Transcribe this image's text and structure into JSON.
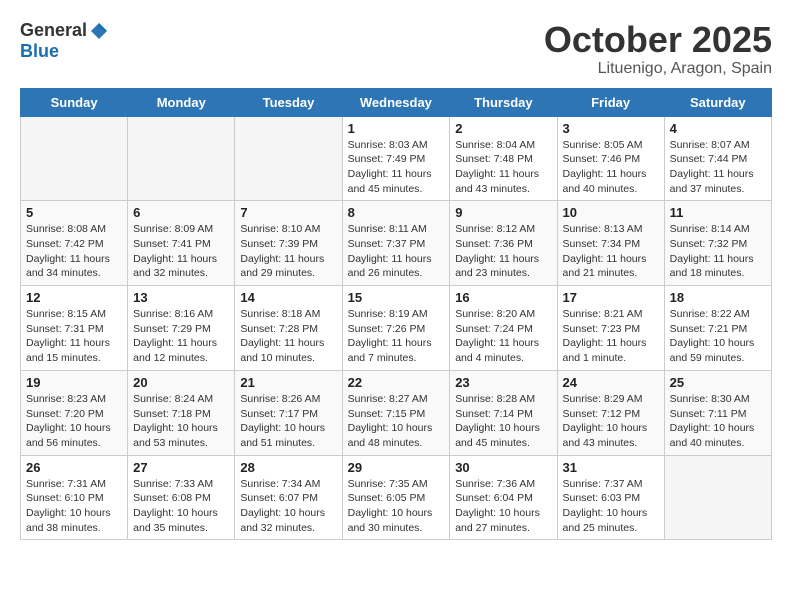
{
  "header": {
    "logo_general": "General",
    "logo_blue": "Blue",
    "month_title": "October 2025",
    "location": "Lituenigo, Aragon, Spain"
  },
  "weekdays": [
    "Sunday",
    "Monday",
    "Tuesday",
    "Wednesday",
    "Thursday",
    "Friday",
    "Saturday"
  ],
  "weeks": [
    [
      {
        "day": "",
        "info": ""
      },
      {
        "day": "",
        "info": ""
      },
      {
        "day": "",
        "info": ""
      },
      {
        "day": "1",
        "info": "Sunrise: 8:03 AM\nSunset: 7:49 PM\nDaylight: 11 hours and 45 minutes."
      },
      {
        "day": "2",
        "info": "Sunrise: 8:04 AM\nSunset: 7:48 PM\nDaylight: 11 hours and 43 minutes."
      },
      {
        "day": "3",
        "info": "Sunrise: 8:05 AM\nSunset: 7:46 PM\nDaylight: 11 hours and 40 minutes."
      },
      {
        "day": "4",
        "info": "Sunrise: 8:07 AM\nSunset: 7:44 PM\nDaylight: 11 hours and 37 minutes."
      }
    ],
    [
      {
        "day": "5",
        "info": "Sunrise: 8:08 AM\nSunset: 7:42 PM\nDaylight: 11 hours and 34 minutes."
      },
      {
        "day": "6",
        "info": "Sunrise: 8:09 AM\nSunset: 7:41 PM\nDaylight: 11 hours and 32 minutes."
      },
      {
        "day": "7",
        "info": "Sunrise: 8:10 AM\nSunset: 7:39 PM\nDaylight: 11 hours and 29 minutes."
      },
      {
        "day": "8",
        "info": "Sunrise: 8:11 AM\nSunset: 7:37 PM\nDaylight: 11 hours and 26 minutes."
      },
      {
        "day": "9",
        "info": "Sunrise: 8:12 AM\nSunset: 7:36 PM\nDaylight: 11 hours and 23 minutes."
      },
      {
        "day": "10",
        "info": "Sunrise: 8:13 AM\nSunset: 7:34 PM\nDaylight: 11 hours and 21 minutes."
      },
      {
        "day": "11",
        "info": "Sunrise: 8:14 AM\nSunset: 7:32 PM\nDaylight: 11 hours and 18 minutes."
      }
    ],
    [
      {
        "day": "12",
        "info": "Sunrise: 8:15 AM\nSunset: 7:31 PM\nDaylight: 11 hours and 15 minutes."
      },
      {
        "day": "13",
        "info": "Sunrise: 8:16 AM\nSunset: 7:29 PM\nDaylight: 11 hours and 12 minutes."
      },
      {
        "day": "14",
        "info": "Sunrise: 8:18 AM\nSunset: 7:28 PM\nDaylight: 11 hours and 10 minutes."
      },
      {
        "day": "15",
        "info": "Sunrise: 8:19 AM\nSunset: 7:26 PM\nDaylight: 11 hours and 7 minutes."
      },
      {
        "day": "16",
        "info": "Sunrise: 8:20 AM\nSunset: 7:24 PM\nDaylight: 11 hours and 4 minutes."
      },
      {
        "day": "17",
        "info": "Sunrise: 8:21 AM\nSunset: 7:23 PM\nDaylight: 11 hours and 1 minute."
      },
      {
        "day": "18",
        "info": "Sunrise: 8:22 AM\nSunset: 7:21 PM\nDaylight: 10 hours and 59 minutes."
      }
    ],
    [
      {
        "day": "19",
        "info": "Sunrise: 8:23 AM\nSunset: 7:20 PM\nDaylight: 10 hours and 56 minutes."
      },
      {
        "day": "20",
        "info": "Sunrise: 8:24 AM\nSunset: 7:18 PM\nDaylight: 10 hours and 53 minutes."
      },
      {
        "day": "21",
        "info": "Sunrise: 8:26 AM\nSunset: 7:17 PM\nDaylight: 10 hours and 51 minutes."
      },
      {
        "day": "22",
        "info": "Sunrise: 8:27 AM\nSunset: 7:15 PM\nDaylight: 10 hours and 48 minutes."
      },
      {
        "day": "23",
        "info": "Sunrise: 8:28 AM\nSunset: 7:14 PM\nDaylight: 10 hours and 45 minutes."
      },
      {
        "day": "24",
        "info": "Sunrise: 8:29 AM\nSunset: 7:12 PM\nDaylight: 10 hours and 43 minutes."
      },
      {
        "day": "25",
        "info": "Sunrise: 8:30 AM\nSunset: 7:11 PM\nDaylight: 10 hours and 40 minutes."
      }
    ],
    [
      {
        "day": "26",
        "info": "Sunrise: 7:31 AM\nSunset: 6:10 PM\nDaylight: 10 hours and 38 minutes."
      },
      {
        "day": "27",
        "info": "Sunrise: 7:33 AM\nSunset: 6:08 PM\nDaylight: 10 hours and 35 minutes."
      },
      {
        "day": "28",
        "info": "Sunrise: 7:34 AM\nSunset: 6:07 PM\nDaylight: 10 hours and 32 minutes."
      },
      {
        "day": "29",
        "info": "Sunrise: 7:35 AM\nSunset: 6:05 PM\nDaylight: 10 hours and 30 minutes."
      },
      {
        "day": "30",
        "info": "Sunrise: 7:36 AM\nSunset: 6:04 PM\nDaylight: 10 hours and 27 minutes."
      },
      {
        "day": "31",
        "info": "Sunrise: 7:37 AM\nSunset: 6:03 PM\nDaylight: 10 hours and 25 minutes."
      },
      {
        "day": "",
        "info": ""
      }
    ]
  ]
}
